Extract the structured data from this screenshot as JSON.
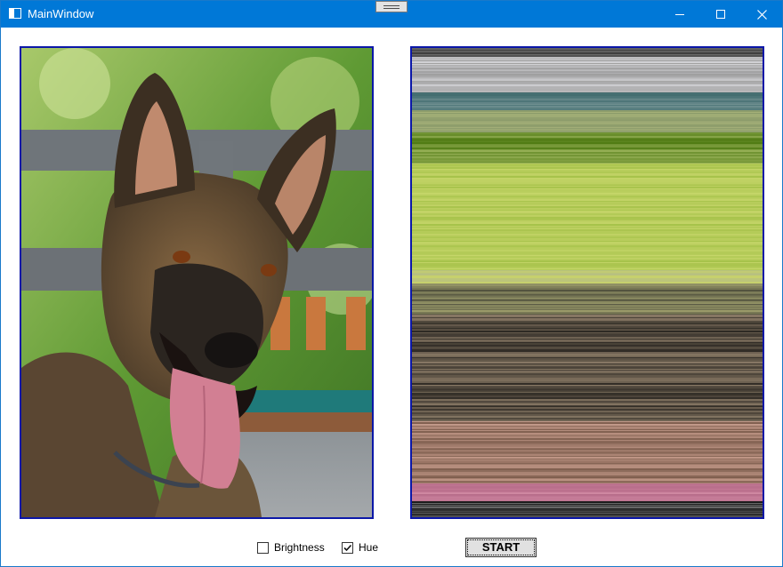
{
  "window": {
    "title": "MainWindow"
  },
  "images": {
    "original": "dog-photo",
    "processed": "pixel-sorted-output"
  },
  "controls": {
    "brightness_label": "Brightness",
    "brightness_checked": false,
    "hue_label": "Hue",
    "hue_checked": true,
    "start_label": "START"
  },
  "colors": {
    "titlebar": "#0078d7",
    "panel_border": "#0b17a8"
  }
}
